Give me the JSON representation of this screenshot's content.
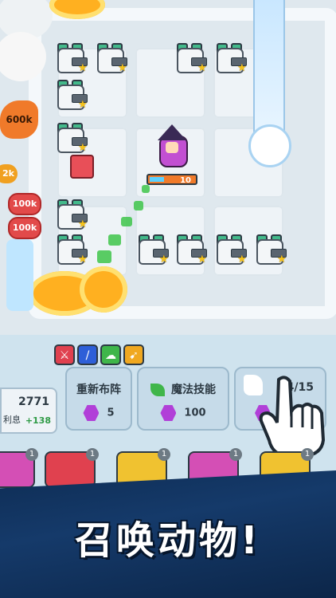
{
  "board": {
    "enemy_hp_badges": [
      "100k",
      "100k"
    ],
    "side_badge": "2k",
    "boss_hp": "600k",
    "witch_level": "10"
  },
  "skills": {
    "icons": [
      "sword-skill-icon",
      "blade-skill-icon",
      "cloud-skill-icon",
      "arrow-skill-icon"
    ],
    "colors": [
      "#e0414f",
      "#2d5fd8",
      "#3fb64a",
      "#f0a820"
    ]
  },
  "score": {
    "value": "2771",
    "label": "利息",
    "income": "+138"
  },
  "actions": [
    {
      "label": "重新布阵",
      "cost": "5"
    },
    {
      "label": "魔法技能",
      "cost": "100"
    },
    {
      "label": "",
      "cost": "14/15"
    }
  ],
  "cards": [
    {
      "count": "1",
      "color": "#d44fb5"
    },
    {
      "count": "1",
      "color": "#e0414f"
    },
    {
      "count": "1",
      "color": "#f0c230"
    },
    {
      "count": "1",
      "color": "#d44fb5"
    },
    {
      "count": "1",
      "color": "#f0c230"
    }
  ],
  "banner": {
    "text": "召唤动物!"
  }
}
